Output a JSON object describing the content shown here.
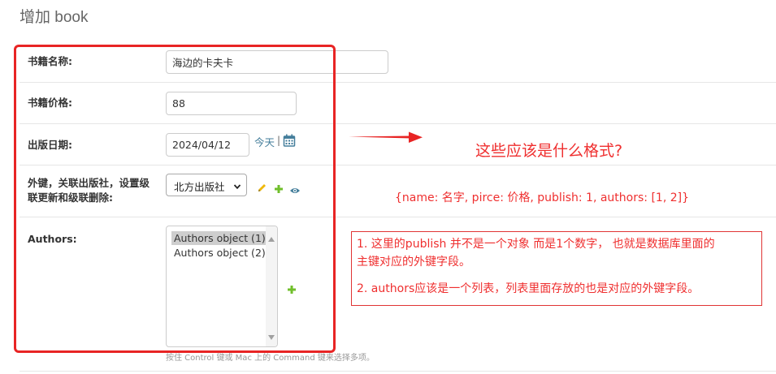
{
  "page": {
    "title": "增加 book"
  },
  "form": {
    "name": {
      "label": "书籍名称:",
      "value": "海边的卡夫卡"
    },
    "price": {
      "label": "书籍价格:",
      "value": "88"
    },
    "pub_date": {
      "label": "出版日期:",
      "value": "2024/04/12",
      "today_link": "今天",
      "separator": "|"
    },
    "publish": {
      "label_line1": "外键，关联出版社，设置级",
      "label_line2": "联更新和级联删除:",
      "selected": "北方出版社"
    },
    "authors": {
      "label": "Authors:",
      "options": [
        "Authors object (1)",
        "Authors object (2)"
      ],
      "selected_index": 0,
      "help": "按住 Control 键或 Mac 上的 Command 键来选择多项。"
    }
  },
  "icons": {
    "calendar": "calendar-icon",
    "edit": "pencil-icon",
    "add": "plus-icon",
    "view": "eye-icon",
    "dropdown": "chevron-down-icon",
    "scroll_up": "scroll-up-icon",
    "scroll_down": "scroll-down-icon"
  },
  "annotations": {
    "question": "这些应该是什么格式?",
    "example": "{name: 名字, pirce: 价格, publish: 1, authors: [1, 2]}",
    "note_line1": "1. 这里的publish 并不是一个对象 而是1个数字， 也就是数据库里面的",
    "note_line2": "主键对应的外键字段。",
    "note_line3": "2. authors应该是一个列表，列表里面存放的也是对应的外键字段。"
  },
  "colors": {
    "accent": "#447e9b",
    "annotation": "#ef2f2f",
    "add_green": "#70bf2b",
    "edit_yellow": "#efb80b"
  }
}
